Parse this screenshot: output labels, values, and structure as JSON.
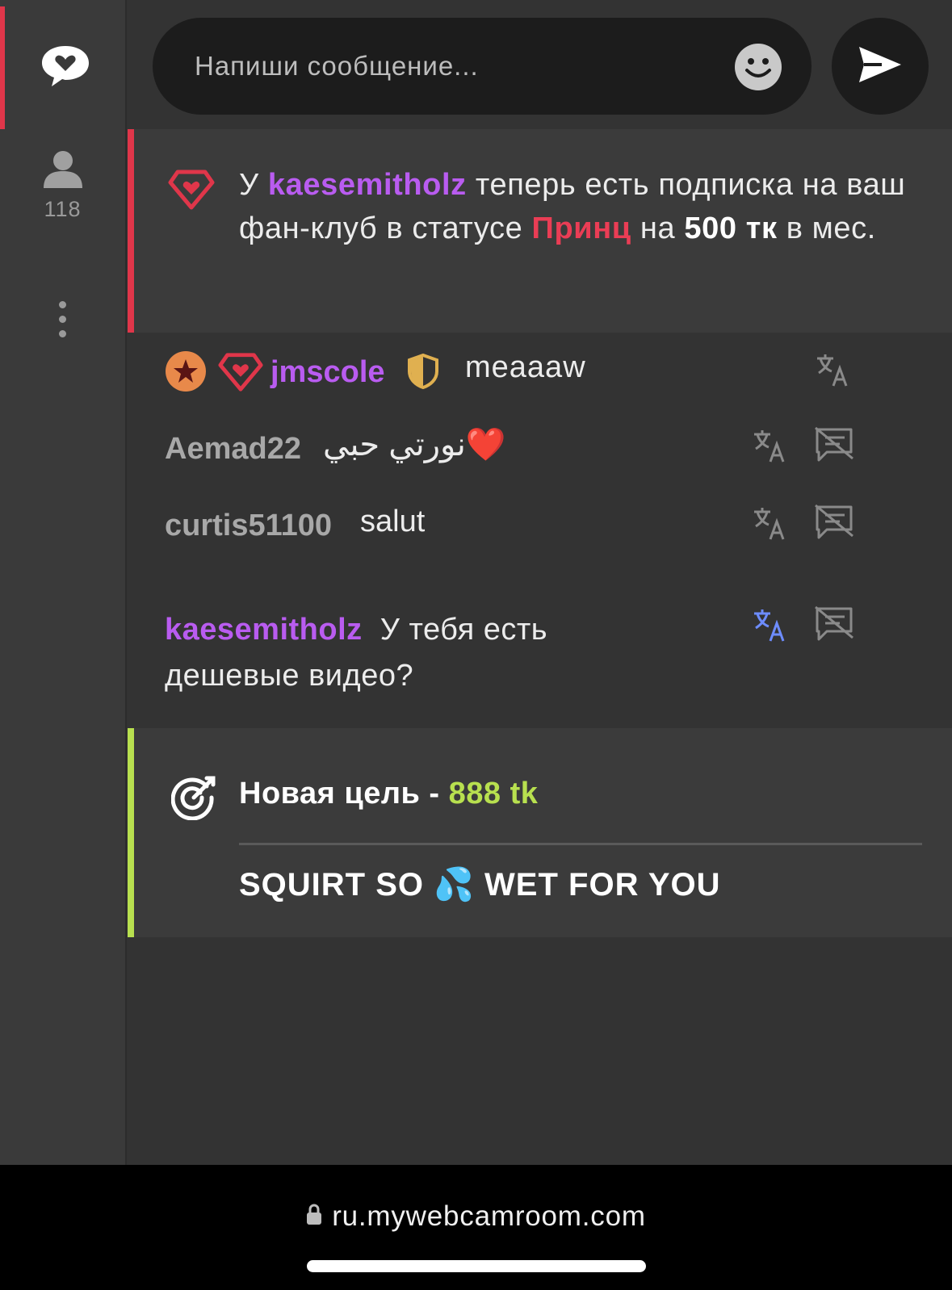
{
  "composer": {
    "placeholder": "Напиши сообщение..."
  },
  "sidebar": {
    "viewer_count": "118"
  },
  "fanclub_notice": {
    "prefix": "У ",
    "username": "kaesemitholz",
    "middle": " теперь есть подписка на ваш фан-клуб в статусе ",
    "tier": "Принц",
    "pre_amount": " на ",
    "amount": "500 тк",
    "suffix": " в мес."
  },
  "messages": [
    {
      "username": "jmscole",
      "text": "meaaaw"
    },
    {
      "username": "Aemad22",
      "text": "نورتي حبي❤️"
    },
    {
      "username": "curtis51100",
      "text": "salut"
    },
    {
      "username": "kaesemitholz",
      "text": "У тебя есть дешевые видео?"
    }
  ],
  "goal": {
    "title": "Новая цель - ",
    "amount": "888 tk",
    "description": "SQUIRT SO 💦 WET FOR YOU"
  },
  "browser": {
    "url": "ru.mywebcamroom.com"
  },
  "colors": {
    "accent_red": "#e0364a",
    "username_purple": "#b95cf0",
    "goal_green": "#b8e04f",
    "translate_active": "#6d8cff"
  }
}
